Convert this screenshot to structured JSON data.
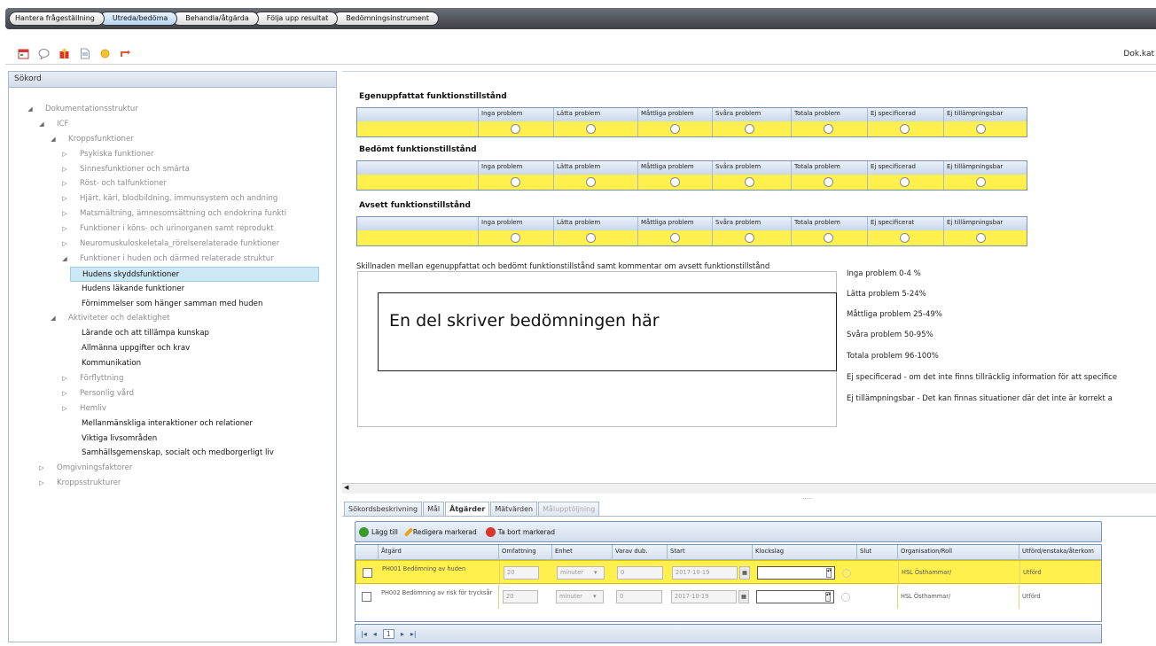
{
  "breadcrumbs": [
    "Hantera frågeställning",
    "Utreda/bedöma",
    "Behandla/åtgärda",
    "Följa upp resultat",
    "Bedömningsinstrument"
  ],
  "active_crumb": "Utreda/bedöma",
  "toolbar": {
    "icons": [
      "calendar-icon",
      "chat-icon",
      "gift-icon",
      "document-icon",
      "sun-icon",
      "refresh-icon"
    ],
    "right_label": "Dok.kat"
  },
  "left_panel": {
    "header": "Sökord",
    "tree": [
      {
        "label": "Dokumentationsstruktur",
        "arrow": "◢"
      },
      {
        "label": "ICF",
        "arrow": "◢"
      },
      {
        "label": "Kroppsfunktioner",
        "arrow": "◢"
      },
      {
        "label": "Psykiska funktioner",
        "arrow": "▷"
      },
      {
        "label": "Sinnesfunktioner och smärta",
        "arrow": "▷"
      },
      {
        "label": "Röst- och talfunktioner",
        "arrow": "▷"
      },
      {
        "label": "Hjärt, kärl, blodbildning, immunsystem och andning",
        "arrow": "▷"
      },
      {
        "label": "Matsmältning, ämnesomsättning och endokrina funkti",
        "arrow": "▷"
      },
      {
        "label": "Funktioner i köns- och urinorganen samt reprodukt",
        "arrow": "▷"
      },
      {
        "label": "Neuromuskuloskeletala_rörelserelaterade funktioner",
        "arrow": "▷"
      },
      {
        "label": "Funktioner i huden och därmed relaterade struktur",
        "arrow": "◢"
      },
      {
        "label": "Hudens skyddsfunktioner",
        "arrow": ""
      },
      {
        "label": "Hudens läkande funktioner",
        "arrow": ""
      },
      {
        "label": "Förnimmelser som hänger samman med huden",
        "arrow": ""
      },
      {
        "label": "Aktiviteter och delaktighet",
        "arrow": "◢"
      },
      {
        "label": "Lärande och att tillämpa kunskap",
        "arrow": ""
      },
      {
        "label": "Allmänna uppgifter och krav",
        "arrow": ""
      },
      {
        "label": "Kommunikation",
        "arrow": ""
      },
      {
        "label": "Förflyttning",
        "arrow": "▷"
      },
      {
        "label": "Personlig vård",
        "arrow": "▷"
      },
      {
        "label": "Hemliv",
        "arrow": "▷"
      },
      {
        "label": "Mellanmänskliga interaktioner och relationer",
        "arrow": ""
      },
      {
        "label": "Viktiga livsområden",
        "arrow": ""
      },
      {
        "label": "Samhällsgemenskap, socialt och medborgerligt liv",
        "arrow": ""
      },
      {
        "label": "Omgivningsfaktorer",
        "arrow": "▷"
      },
      {
        "label": "Kroppsstrukturer",
        "arrow": "▷"
      }
    ]
  },
  "sections": [
    {
      "title": "Egenuppfattat funktionstillstånd",
      "options": [
        "Inga problem",
        "Lätta problem",
        "Måttliga problem",
        "Svåra problem",
        "Totala problem",
        "Ej specificerad",
        "Ej tillämpningsbar"
      ]
    },
    {
      "title": "Bedömt funktionstillstånd",
      "options": [
        "Inga problem",
        "Lätta problem",
        "Måttliga problem",
        "Svåra problem",
        "Totala problem",
        "Ej specificerad",
        "Ej tillämpningsbar"
      ]
    },
    {
      "title": "Avsett funktionstillstånd",
      "options": [
        "Inga problem",
        "Lätta problem",
        "Måttliga problem",
        "Svåra problem",
        "Totala problem",
        "Ej specificerat",
        "Ej tillämpningsbar"
      ]
    }
  ],
  "difference_label": "Skillnaden mellan egenuppfattat och bedömt funktionstillstånd samt kommentar om avsett funktionstillstånd",
  "callout_text": "En del skriver bedömningen här",
  "legend": [
    "Inga problem 0-4 %",
    "Lätta problem 5-24%",
    "Måttliga problem 25-49%",
    "Svåra problem 50-95%",
    "Totala problem 96-100%",
    "Ej specificerad - om det inte finns tillräcklig information för att specifice",
    "Ej tillämpningsbar - Det kan finnas situationer där det inte är korrekt a"
  ],
  "tabs": [
    "Sökordsbeskrivning",
    "Mål",
    "Åtgärder",
    "Mätvärden",
    "Målupptöljning"
  ],
  "active_tab": "Åtgärder",
  "atgarder": {
    "buttons": [
      "Lägg till",
      "Redigera markerad",
      "Ta bort markerad"
    ],
    "columns": [
      "Åtgärd",
      "Omfattning",
      "Enhet",
      "Varav dub.",
      "Start",
      "Klockslag",
      "Slut",
      "Organisation/Roll",
      "Utförd/enstaka/återkom"
    ],
    "rows": [
      {
        "atgard": "PH001 Bedömning av huden",
        "omfattning": "20",
        "enhet": "minuter",
        "varav": "0",
        "start": "2017-10-19",
        "klockslag": "",
        "slut": "",
        "org": "HSL Östhammar/",
        "status": "Utförd"
      },
      {
        "atgard": "PH002 Bedömning av risk för trycksår",
        "omfattning": "20",
        "enhet": "minuter",
        "varav": "0",
        "start": "2017-10-19",
        "klockslag": "",
        "slut": "",
        "org": "HSL Östhammar/",
        "status": "Utförd"
      }
    ],
    "pager": {
      "page": "1"
    }
  }
}
